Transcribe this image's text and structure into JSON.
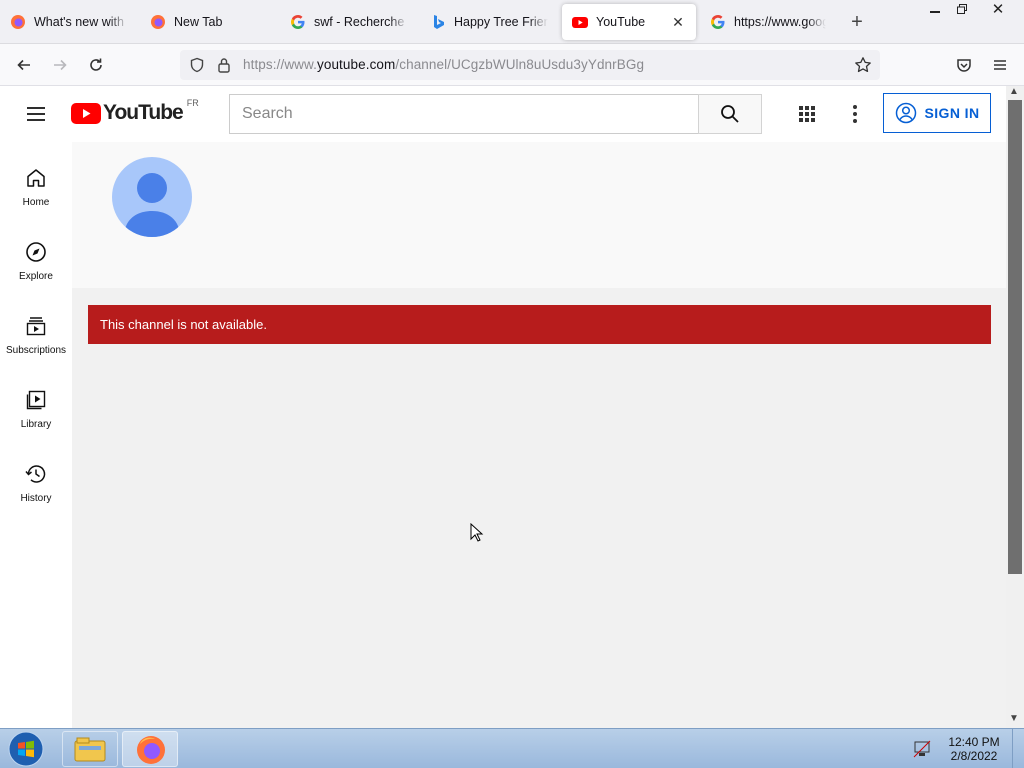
{
  "browser": {
    "tabs": [
      {
        "title": "What's new with Firefox",
        "favicon": "firefox-icon",
        "active": false
      },
      {
        "title": "New Tab",
        "favicon": "firefox-icon",
        "active": false
      },
      {
        "title": "swf - Recherche Google",
        "favicon": "google-icon",
        "active": false
      },
      {
        "title": "Happy Tree Friends",
        "favicon": "bing-icon",
        "active": false
      },
      {
        "title": "YouTube",
        "favicon": "youtube-icon",
        "active": true
      },
      {
        "title": "https://www.google.com",
        "favicon": "google-icon",
        "active": false
      }
    ],
    "url_prefix": "https://www.",
    "url_domain": "youtube.com",
    "url_path": "/channel/UCgzbWUln8uUsdu3yYdnrBGg"
  },
  "youtube": {
    "logo_text": "YouTube",
    "region": "FR",
    "search_placeholder": "Search",
    "signin_label": "SIGN IN",
    "brand_color": "#ff0000",
    "link_color": "#065fd4"
  },
  "guide": [
    {
      "label": "Home",
      "icon": "home-icon"
    },
    {
      "label": "Explore",
      "icon": "compass-icon"
    },
    {
      "label": "Subscriptions",
      "icon": "subscriptions-icon"
    },
    {
      "label": "Library",
      "icon": "library-icon"
    },
    {
      "label": "History",
      "icon": "history-icon"
    }
  ],
  "channel": {
    "alert_message": "This channel is not available.",
    "alert_color": "#b71c1c"
  },
  "taskbar": {
    "time": "12:40 PM",
    "date": "2/8/2022"
  }
}
